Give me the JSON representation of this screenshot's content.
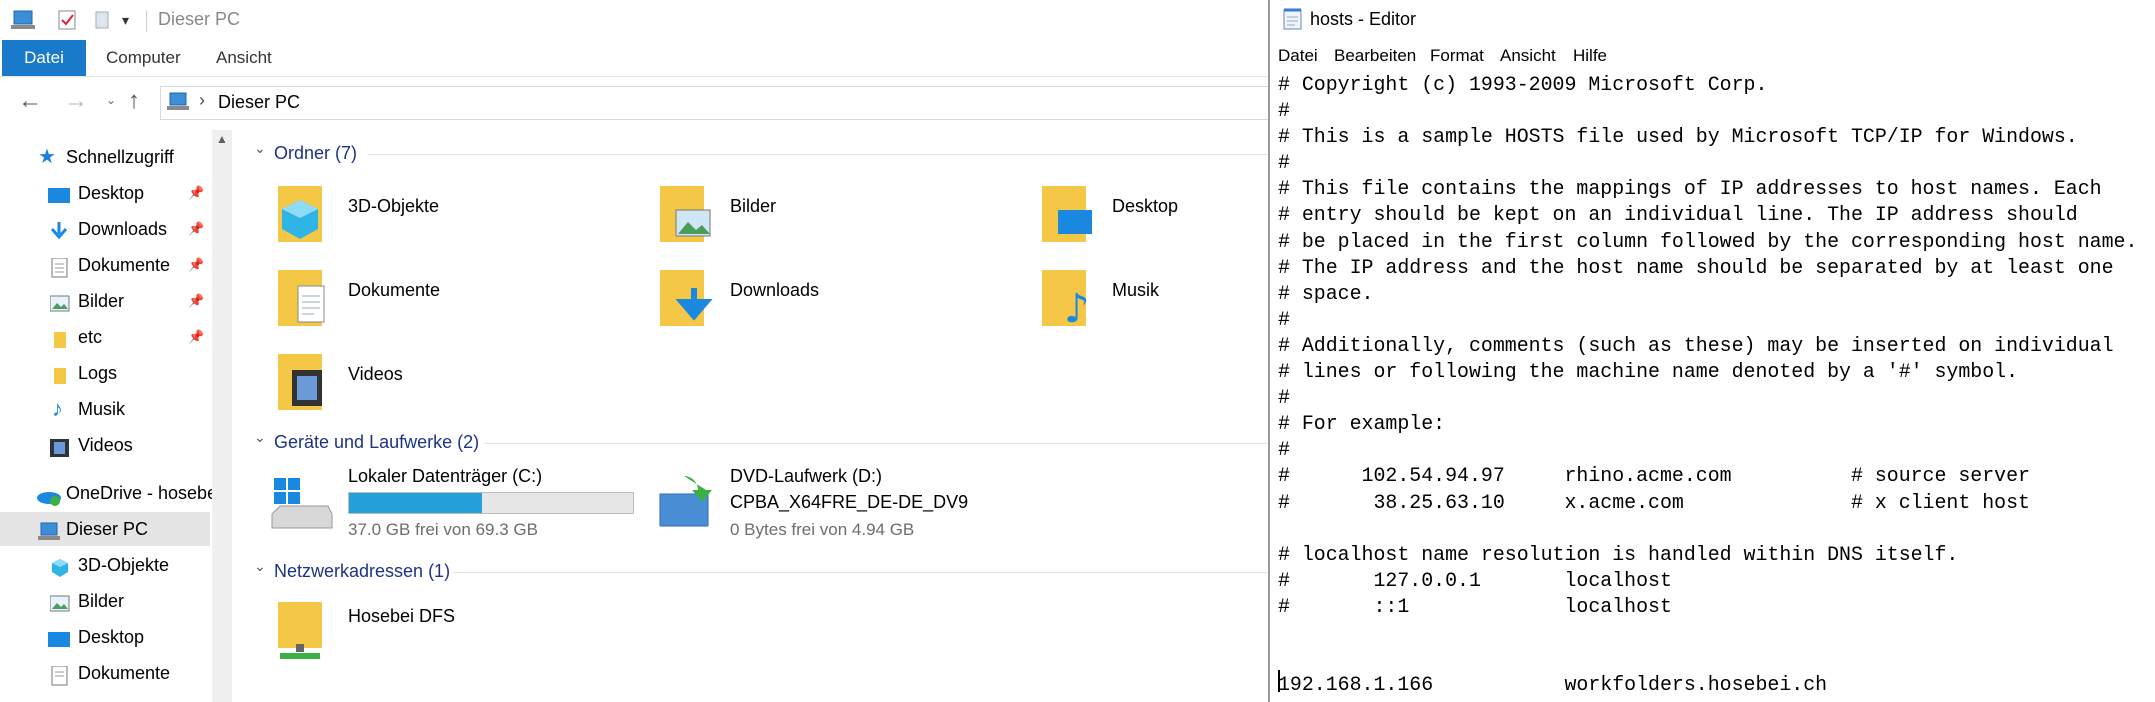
{
  "explorer": {
    "title": "Dieser PC",
    "ribbon_tabs": [
      "Datei",
      "Computer",
      "Ansicht"
    ],
    "address_path": "Dieser PC",
    "nav": [
      {
        "label": "Schnellzugriff",
        "icon": "star-icon",
        "pinned": false
      },
      {
        "label": "Desktop",
        "icon": "desktop-icon",
        "pinned": true
      },
      {
        "label": "Downloads",
        "icon": "download-arrow-icon",
        "pinned": true
      },
      {
        "label": "Dokumente",
        "icon": "document-icon",
        "pinned": true
      },
      {
        "label": "Bilder",
        "icon": "picture-icon",
        "pinned": true
      },
      {
        "label": "etc",
        "icon": "folder-icon",
        "pinned": true
      },
      {
        "label": "Logs",
        "icon": "folder-icon",
        "pinned": false
      },
      {
        "label": "Musik",
        "icon": "music-note-icon",
        "pinned": false
      },
      {
        "label": "Videos",
        "icon": "video-icon",
        "pinned": false
      },
      {
        "label": "OneDrive - hosebei",
        "icon": "onedrive-icon",
        "pinned": false
      },
      {
        "label": "Dieser PC",
        "icon": "computer-icon",
        "pinned": false
      },
      {
        "label": "3D-Objekte",
        "icon": "cube-icon",
        "pinned": false
      },
      {
        "label": "Bilder",
        "icon": "picture-icon",
        "pinned": false
      },
      {
        "label": "Desktop",
        "icon": "desktop-icon",
        "pinned": false
      },
      {
        "label": "Dokumente",
        "icon": "document-icon",
        "pinned": false
      }
    ],
    "groups": {
      "folders": "Ordner (7)",
      "drives": "Geräte und Laufwerke (2)",
      "network": "Netzwerkadressen (1)"
    },
    "folders": [
      "3D-Objekte",
      "Bilder",
      "Desktop",
      "Dokumente",
      "Downloads",
      "Musik",
      "Videos"
    ],
    "drives": [
      {
        "name": "Lokaler Datenträger (C:)",
        "free": "37.0 GB frei von 69.3 GB",
        "used_fraction": 0.47
      },
      {
        "name": "DVD-Laufwerk (D:)",
        "volume": "CPBA_X64FRE_DE-DE_DV9",
        "free": "0 Bytes frei von 4.94 GB"
      }
    ],
    "network": [
      "Hosebei DFS"
    ]
  },
  "editor": {
    "title": "hosts - Editor",
    "menu": [
      "Datei",
      "Bearbeiten",
      "Format",
      "Ansicht",
      "Hilfe"
    ],
    "lines": [
      "# Copyright (c) 1993-2009 Microsoft Corp.",
      "#",
      "# This is a sample HOSTS file used by Microsoft TCP/IP for Windows.",
      "#",
      "# This file contains the mappings of IP addresses to host names. Each",
      "# entry should be kept on an individual line. The IP address should",
      "# be placed in the first column followed by the corresponding host name.",
      "# The IP address and the host name should be separated by at least one",
      "# space.",
      "#",
      "# Additionally, comments (such as these) may be inserted on individual",
      "# lines or following the machine name denoted by a '#' symbol.",
      "#",
      "# For example:",
      "#",
      "#      102.54.94.97     rhino.acme.com          # source server",
      "#       38.25.63.10     x.acme.com              # x client host",
      "",
      "# localhost name resolution is handled within DNS itself.",
      "#       127.0.0.1       localhost",
      "#       ::1             localhost",
      "",
      "",
      "192.168.1.166           workfolders.hosebei.ch"
    ]
  }
}
